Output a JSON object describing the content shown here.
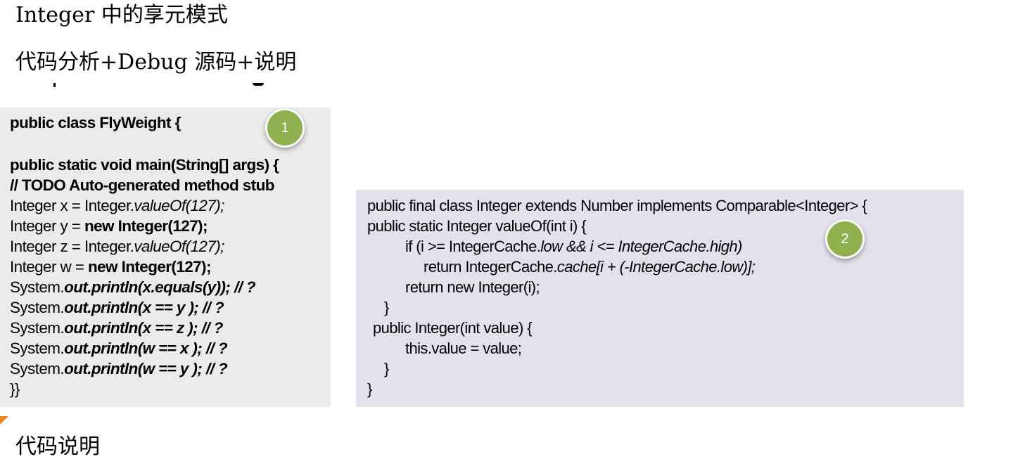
{
  "headings": {
    "title": "Integer 中的享元模式",
    "subtitle": "代码分析+Debug 源码+说明",
    "footer": "代码说明"
  },
  "panel1": {
    "l1": "public class FlyWeight {",
    "l2": "public static void main(String[] args) {",
    "l3": "// TODO Auto-generated method stub",
    "l4a": "Integer x = Integer.",
    "l4b": "valueOf(127);",
    "l5a": "Integer y = ",
    "l5b": "new Integer(127);",
    "l6a": "Integer z = Integer.",
    "l6b": "valueOf(127);",
    "l7a": "Integer w = ",
    "l7b": "new Integer(127);",
    "l8a": "System.",
    "l8b": "out.println(x.equals(y)); // ?",
    "l9a": "System.",
    "l9b": "out.println(x == y ); // ?",
    "l10a": "System.",
    "l10b": "out.println(x == z ); // ?",
    "l11a": "System.",
    "l11b": "out.println(w == x ); // ?",
    "l12a": "System.",
    "l12b": "out.println(w == y ); // ?",
    "l13": "}}"
  },
  "panel2": {
    "l1": "public final class Integer extends Number implements Comparable<Integer> {",
    "l2": "public static Integer valueOf(int i) {",
    "l3a": "if (i >= IntegerCache.",
    "l3b": "low && i <= IntegerCache.high)",
    "l4a": "return IntegerCache.",
    "l4b": "cache[i + (-IntegerCache.low)];",
    "l5": "return new Integer(i);",
    "l6": "}",
    "l7": "public Integer(int value) {",
    "l8": "this.value = value;",
    "l9": "}",
    "l10": "}"
  },
  "markers": {
    "m1": "1",
    "m2": "2"
  },
  "colors": {
    "marker": "#8fb04f",
    "panel1_bg": "#ebebeb",
    "panel2_bg": "#e4e1ec"
  }
}
